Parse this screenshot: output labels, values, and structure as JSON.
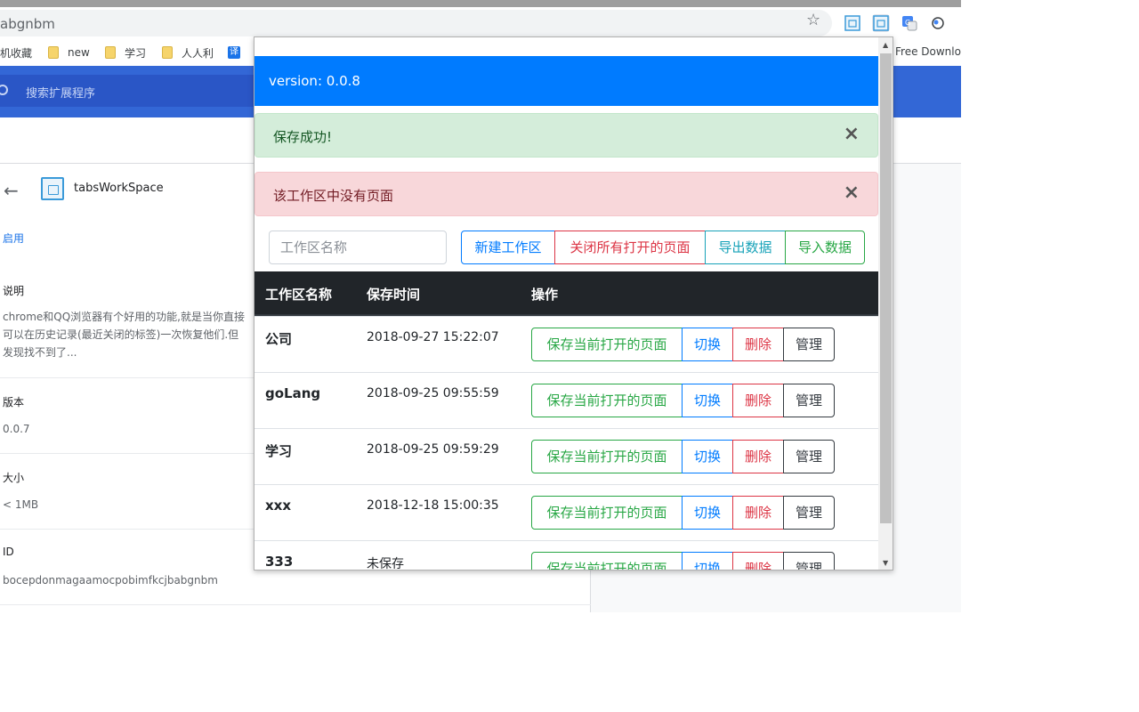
{
  "browser": {
    "url": "abgnbm",
    "bookmarks": [
      "机收藏",
      "new",
      "学习",
      "人人利",
      "译",
      "Free Downlo"
    ]
  },
  "extpage": {
    "search_placeholder": "搜索扩展程序",
    "app_name": "tabsWorkSpace",
    "enable_label": "启用",
    "desc_label": "说明",
    "desc_text": "chrome和QQ浏览器有个好用的功能,就是当你直接…可以在历史记录(最近关闭的标签)一次恢复他们.但…发现找不到了...",
    "desc_line1": "chrome和QQ浏览器有个好用的功能,就是当你直接",
    "desc_line2": "可以在历史记录(最近关闭的标签)一次恢复他们.但",
    "desc_line3": "发现找不到了...",
    "version_label": "版本",
    "version_value": "0.0.7",
    "size_label": "大小",
    "size_value": "< 1MB",
    "id_label": "ID",
    "id_value": "bocepdonmagaamocpobimfkcjbabgnbm"
  },
  "popup": {
    "version": "version: 0.0.8",
    "alert_success": "保存成功!",
    "alert_danger": "该工作区中没有页面",
    "close_symbol": "×",
    "input_placeholder": "工作区名称",
    "buttons": {
      "new": "新建工作区",
      "close_all": "关闭所有打开的页面",
      "export": "导出数据",
      "import": "导入数据"
    },
    "table": {
      "headers": [
        "工作区名称",
        "保存时间",
        "操作"
      ],
      "row_actions": {
        "save": "保存当前打开的页面",
        "switch": "切换",
        "delete": "删除",
        "manage": "管理"
      },
      "rows": [
        {
          "name": "公司",
          "time": "2018-09-27 15:22:07"
        },
        {
          "name": "goLang",
          "time": "2018-09-25 09:55:59"
        },
        {
          "name": "学习",
          "time": "2018-09-25 09:59:29"
        },
        {
          "name": "xxx",
          "time": "2018-12-18 15:00:35"
        },
        {
          "name": "333",
          "time": "未保存"
        }
      ]
    }
  }
}
